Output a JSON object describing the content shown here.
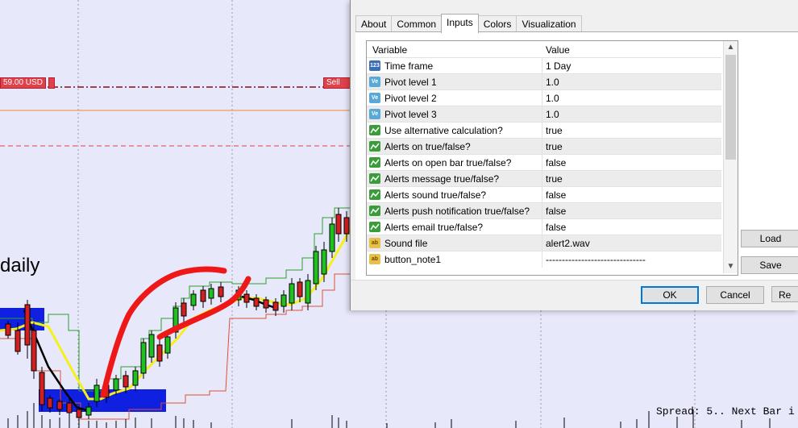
{
  "chart": {
    "price_tag_left": "59.00 USD",
    "price_tag_right": "Sell",
    "label": "daily",
    "spread_text": "Spread: 5.. Next Bar i"
  },
  "dialog": {
    "tabs": [
      "About",
      "Common",
      "Inputs",
      "Colors",
      "Visualization"
    ],
    "active_tab": "Inputs",
    "grid": {
      "headers": {
        "variable": "Variable",
        "value": "Value"
      },
      "rows": [
        {
          "icon": "123",
          "type": "num",
          "variable": "Time frame",
          "value": "1 Day"
        },
        {
          "icon": "Ve",
          "type": "ve",
          "variable": "Pivot level 1",
          "value": "1.0"
        },
        {
          "icon": "Ve",
          "type": "ve",
          "variable": "Pivot level 2",
          "value": "1.0"
        },
        {
          "icon": "Ve",
          "type": "ve",
          "variable": "Pivot level 3",
          "value": "1.0"
        },
        {
          "icon": "",
          "type": "bool",
          "variable": "Use alternative calculation?",
          "value": "true"
        },
        {
          "icon": "",
          "type": "bool",
          "variable": "Alerts on true/false?",
          "value": "true"
        },
        {
          "icon": "",
          "type": "bool",
          "variable": "Alerts on open bar true/false?",
          "value": "false"
        },
        {
          "icon": "",
          "type": "bool",
          "variable": "Alerts message true/false?",
          "value": "true"
        },
        {
          "icon": "",
          "type": "bool",
          "variable": "Alerts sound true/false?",
          "value": "false"
        },
        {
          "icon": "",
          "type": "bool",
          "variable": "Alerts push notification true/false?",
          "value": "false"
        },
        {
          "icon": "",
          "type": "bool",
          "variable": "Alerts email true/false?",
          "value": "false"
        },
        {
          "icon": "ab",
          "type": "ab",
          "variable": "Sound file",
          "value": "alert2.wav"
        },
        {
          "icon": "ab",
          "type": "ab",
          "variable": "button_note1",
          "value": "-------------------------------"
        }
      ]
    },
    "buttons": {
      "load": "Load",
      "save": "Save",
      "ok": "OK",
      "cancel": "Cancel",
      "reset": "Re"
    }
  }
}
